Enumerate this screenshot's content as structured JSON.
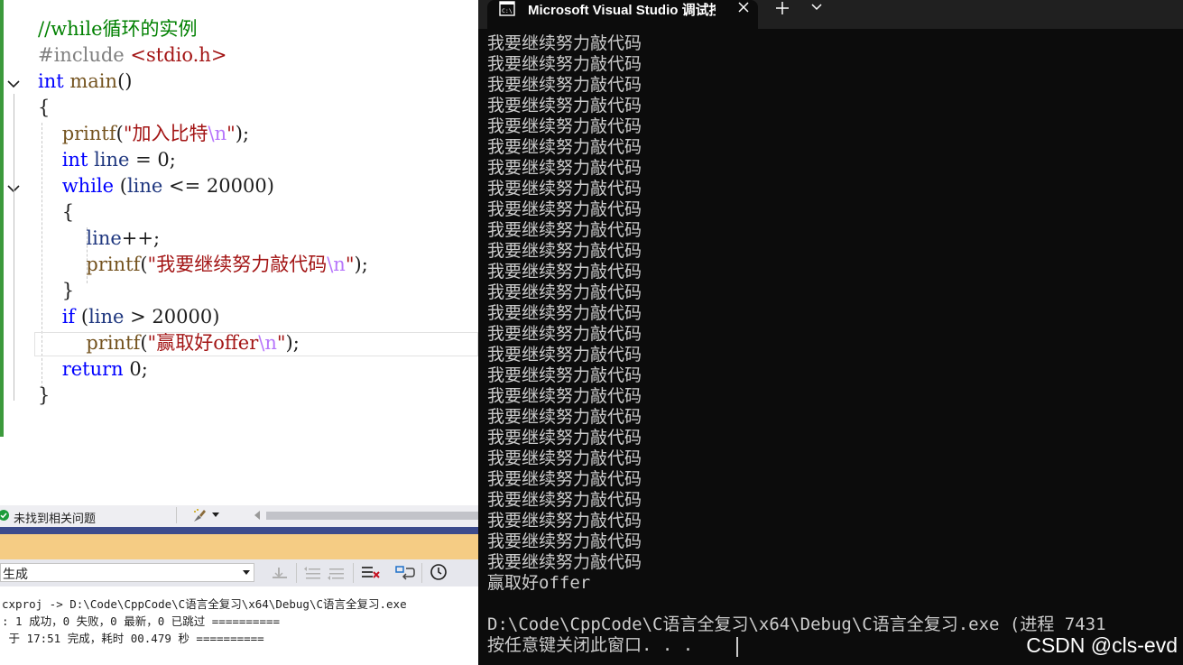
{
  "editor": {
    "lines": [
      {
        "parts": [
          {
            "t": "//while循环的实例",
            "c": "cm"
          }
        ]
      },
      {
        "parts": [
          {
            "t": "#include ",
            "c": "pp"
          },
          {
            "t": "<stdio.h>",
            "c": "pi"
          }
        ]
      },
      {
        "parts": [
          {
            "t": "int",
            "c": "kw"
          },
          {
            "t": " "
          },
          {
            "t": "main",
            "c": "fn"
          },
          {
            "t": "()"
          }
        ]
      },
      {
        "parts": [
          {
            "t": "{"
          }
        ]
      },
      {
        "parts": [
          {
            "t": "    "
          },
          {
            "t": "printf",
            "c": "fn"
          },
          {
            "t": "("
          },
          {
            "t": "\"加入比特",
            "c": "str"
          },
          {
            "t": "\\n",
            "c": "esc"
          },
          {
            "t": "\"",
            "c": "str"
          },
          {
            "t": ");"
          }
        ]
      },
      {
        "parts": [
          {
            "t": "    "
          },
          {
            "t": "int",
            "c": "kw"
          },
          {
            "t": " "
          },
          {
            "t": "line",
            "c": "id"
          },
          {
            "t": " = 0;"
          }
        ]
      },
      {
        "parts": [
          {
            "t": "    "
          },
          {
            "t": "while",
            "c": "kw"
          },
          {
            "t": " ("
          },
          {
            "t": "line",
            "c": "id"
          },
          {
            "t": " <= 20000)"
          }
        ]
      },
      {
        "parts": [
          {
            "t": "    {"
          }
        ]
      },
      {
        "parts": [
          {
            "t": "        "
          },
          {
            "t": "line",
            "c": "id"
          },
          {
            "t": "++;"
          }
        ]
      },
      {
        "parts": [
          {
            "t": "        "
          },
          {
            "t": "printf",
            "c": "fn"
          },
          {
            "t": "("
          },
          {
            "t": "\"我要继续努力敲代码",
            "c": "str"
          },
          {
            "t": "\\n",
            "c": "esc"
          },
          {
            "t": "\"",
            "c": "str"
          },
          {
            "t": ");"
          }
        ]
      },
      {
        "parts": [
          {
            "t": "    }"
          }
        ]
      },
      {
        "parts": [
          {
            "t": "    "
          },
          {
            "t": "if",
            "c": "kw"
          },
          {
            "t": " ("
          },
          {
            "t": "line",
            "c": "id"
          },
          {
            "t": " > 20000)"
          }
        ]
      },
      {
        "parts": [
          {
            "t": "        "
          },
          {
            "t": "printf",
            "c": "fn"
          },
          {
            "t": "("
          },
          {
            "t": "\"赢取好offer",
            "c": "str"
          },
          {
            "t": "\\n",
            "c": "esc"
          },
          {
            "t": "\"",
            "c": "str"
          },
          {
            "t": ");"
          }
        ]
      },
      {
        "parts": [
          {
            "t": "    "
          },
          {
            "t": "return",
            "c": "kw"
          },
          {
            "t": " 0;"
          }
        ]
      },
      {
        "parts": [
          {
            "t": "}"
          }
        ]
      }
    ]
  },
  "statusbar": {
    "issues": "未找到相关问题"
  },
  "output": {
    "source_select": "生成",
    "lines": [
      "cxproj -> D:\\Code\\CppCode\\C语言全复习\\x64\\Debug\\C语言全复习.exe",
      ": 1 成功，0 失败，0 最新，0 已跳过 ==========",
      " 于 17:51 完成，耗时 00.479 秒 =========="
    ]
  },
  "console": {
    "tab_title": "Microsoft Visual Studio 调试控",
    "lines": [
      "我要继续努力敲代码",
      "我要继续努力敲代码",
      "我要继续努力敲代码",
      "我要继续努力敲代码",
      "我要继续努力敲代码",
      "我要继续努力敲代码",
      "我要继续努力敲代码",
      "我要继续努力敲代码",
      "我要继续努力敲代码",
      "我要继续努力敲代码",
      "我要继续努力敲代码",
      "我要继续努力敲代码",
      "我要继续努力敲代码",
      "我要继续努力敲代码",
      "我要继续努力敲代码",
      "我要继续努力敲代码",
      "我要继续努力敲代码",
      "我要继续努力敲代码",
      "我要继续努力敲代码",
      "我要继续努力敲代码",
      "我要继续努力敲代码",
      "我要继续努力敲代码",
      "我要继续努力敲代码",
      "我要继续努力敲代码",
      "我要继续努力敲代码",
      "我要继续努力敲代码",
      "赢取好offer",
      "",
      "D:\\Code\\CppCode\\C语言全复习\\x64\\Debug\\C语言全复习.exe (进程 7431",
      "按任意键关闭此窗口. . ."
    ],
    "watermark": "CSDN @cls-evd"
  },
  "colors": {
    "keyword": "#0000ff",
    "string": "#a31515",
    "comment": "#008000",
    "escape": "#b776fb",
    "console_bg": "#0c0c0c",
    "output_title_bg": "#f5cc84"
  }
}
